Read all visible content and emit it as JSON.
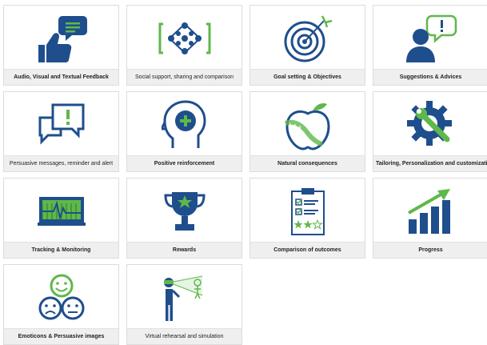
{
  "colors": {
    "navy": "#1f4e8c",
    "green": "#5fb84a",
    "border": "#dcdcdc",
    "label_bg": "#efefef"
  },
  "cards": [
    {
      "label": "Audio, Visual and Textual Feedback",
      "icon": "thumbs-up-chat-icon"
    },
    {
      "label": "Social support, sharing and comparison",
      "icon": "network-people-icon"
    },
    {
      "label": "Goal setting & Objectives",
      "icon": "target-icon"
    },
    {
      "label": "Suggestions & Advices",
      "icon": "person-speech-icon"
    },
    {
      "label": "Persuasive messages, reminder and alert",
      "icon": "alert-bubbles-icon"
    },
    {
      "label": "Positive reinforcement",
      "icon": "head-plus-icon"
    },
    {
      "label": "Natural consequences",
      "icon": "apple-tape-icon"
    },
    {
      "label": "Tailoring, Personalization and customization",
      "icon": "gear-wrench-icon"
    },
    {
      "label": "Tracking & Monitoring",
      "icon": "heart-monitor-icon"
    },
    {
      "label": "Rewards",
      "icon": "trophy-icon"
    },
    {
      "label": "Comparison of outcomes",
      "icon": "clipboard-checklist-icon"
    },
    {
      "label": "Progress",
      "icon": "bar-chart-arrow-icon"
    },
    {
      "label": "Emoticons & Persuasive images",
      "icon": "emoticons-icon"
    },
    {
      "label": "Virtual rehearsal and simulation",
      "icon": "vr-simulation-icon"
    }
  ]
}
